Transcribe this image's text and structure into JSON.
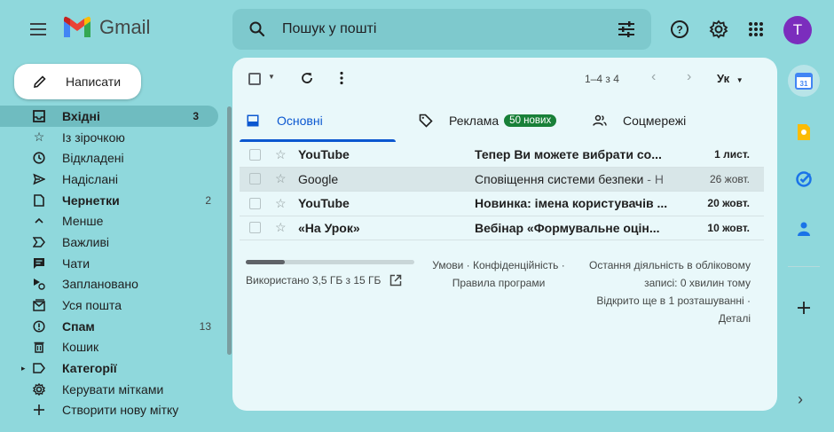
{
  "app": {
    "name": "Gmail",
    "avatar_letter": "T"
  },
  "search": {
    "placeholder": "Пошук у пошті"
  },
  "compose": {
    "label": "Написати"
  },
  "sidebar": {
    "items": [
      {
        "label": "Вхідні",
        "count": "3",
        "icon": "inbox-icon",
        "active": true,
        "bold": true
      },
      {
        "label": "Із зірочкою",
        "count": "",
        "icon": "star-icon"
      },
      {
        "label": "Відкладені",
        "count": "",
        "icon": "clock-icon"
      },
      {
        "label": "Надіслані",
        "count": "",
        "icon": "send-icon"
      },
      {
        "label": "Чернетки",
        "count": "2",
        "icon": "draft-icon",
        "bold": true
      },
      {
        "label": "Менше",
        "count": "",
        "icon": "chevron-up-icon"
      },
      {
        "label": "Важливі",
        "count": "",
        "icon": "important-icon"
      },
      {
        "label": "Чати",
        "count": "",
        "icon": "chat-icon"
      },
      {
        "label": "Заплановано",
        "count": "",
        "icon": "scheduled-icon"
      },
      {
        "label": "Уся пошта",
        "count": "",
        "icon": "all-mail-icon"
      },
      {
        "label": "Спам",
        "count": "13",
        "icon": "spam-icon",
        "bold": true
      },
      {
        "label": "Кошик",
        "count": "",
        "icon": "trash-icon"
      },
      {
        "label": "Категорії",
        "count": "",
        "icon": "label-icon",
        "bold": true
      },
      {
        "label": "Керувати мітками",
        "count": "",
        "icon": "manage-labels-icon"
      },
      {
        "label": "Створити нову мітку",
        "count": "",
        "icon": "plus-icon"
      }
    ]
  },
  "toolbar": {
    "pagination": "1–4 з 4",
    "input_tool": "Ук"
  },
  "tabs": [
    {
      "label": "Основні",
      "active": true,
      "icon": "inbox-tab-icon",
      "badge": ""
    },
    {
      "label": "Реклама",
      "active": false,
      "icon": "tag-icon",
      "badge": "50 нових"
    },
    {
      "label": "Соцмережі",
      "active": false,
      "icon": "people-icon",
      "badge": ""
    }
  ],
  "emails": [
    {
      "sender": "YouTube",
      "subject": "Тепер Ви можете вибрати со...",
      "snippet": "",
      "date": "1 лист.",
      "unread": true
    },
    {
      "sender": "Google",
      "subject": "Сповіщення системи безпеки",
      "snippet": " - Н",
      "date": "26 жовт.",
      "unread": false
    },
    {
      "sender": "YouTube",
      "subject": "Новинка: імена користувачів ...",
      "snippet": "",
      "date": "20 жовт.",
      "unread": true
    },
    {
      "sender": "«На Урок»",
      "subject": "Вебінар «Формувальне оцін...",
      "snippet": "",
      "date": "10 жовт.",
      "unread": true
    }
  ],
  "footer": {
    "storage_text": "Використано 3,5 ГБ з 15 ГБ",
    "storage_fraction": 0.23,
    "links_line1": "Умови · Конфіденційність ·",
    "links_line2": "Правила програми",
    "activity_line1": "Остання діяльність в обліковому",
    "activity_line2": "записі: 0 хвилин тому",
    "activity_line3": "Відкрито ще в 1 розташуванні ·",
    "activity_line4": "Деталі"
  },
  "colors": {
    "background": "#8fd8dc",
    "accent": "#0b57d0",
    "badge": "#188038",
    "avatar": "#7b2dbd"
  }
}
